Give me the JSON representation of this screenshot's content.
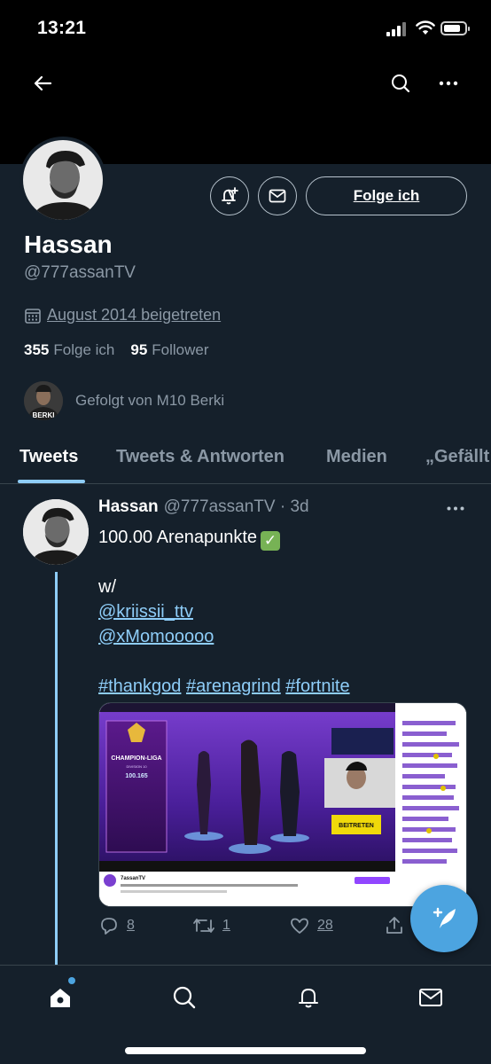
{
  "status_bar": {
    "time": "13:21"
  },
  "profile": {
    "display_name": "Hassan",
    "handle": "@777assanTV",
    "joined": "August 2014 beigetreten",
    "following_count": "355",
    "following_label": "Folge ich",
    "followers_count": "95",
    "followers_label": "Follower",
    "followed_by": "Gefolgt von M10 Berki",
    "follow_button_label": "Folge ich",
    "mini_avatar_text": "BERKI"
  },
  "tabs": [
    {
      "label": "Tweets",
      "active": true
    },
    {
      "label": "Tweets & Antworten",
      "active": false
    },
    {
      "label": "Medien",
      "active": false
    },
    {
      "label": "„Gefällt",
      "active": false
    }
  ],
  "tweet": {
    "author_name": "Hassan",
    "author_handle": "@777assanTV",
    "time": "· 3d",
    "line1": "100.00 Arenapunkte",
    "line2": "w/",
    "mention1": "@kriissii_ttv",
    "mention2": "@xMomooooo",
    "hashtag1": "#thankgod",
    "hashtag2": "#arenagrind",
    "hashtag3": "#fortnite",
    "media": {
      "league_title": "CHAMPION-LIGA",
      "division": "DIVISION 10",
      "points": "100.165",
      "join_button": "BEITRETEN",
      "channel_name": "7assanTV"
    },
    "reply_count": "8",
    "retweet_count": "1",
    "like_count": "28"
  },
  "colors": {
    "background": "#15202b",
    "accent": "#8ecdf8",
    "fab": "#4ca4e0",
    "secondary_text": "#8b98a5"
  },
  "icons": [
    "back-arrow-icon",
    "search-icon",
    "more-icon",
    "bell-plus-icon",
    "mail-icon",
    "calendar-icon",
    "reply-icon",
    "retweet-icon",
    "like-icon",
    "share-icon",
    "compose-icon",
    "home-icon",
    "notifications-icon"
  ]
}
